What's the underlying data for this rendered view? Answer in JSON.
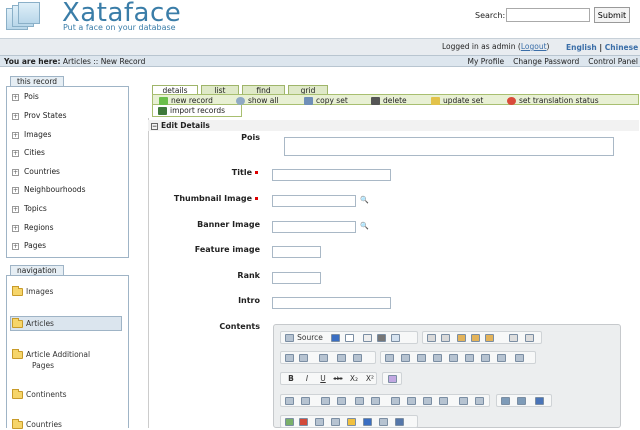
{
  "header": {
    "brand": "Xataface",
    "tagline": "Put a face on your database",
    "search_label": "Search:",
    "search_value": "",
    "submit_label": "Submit"
  },
  "status_bar": {
    "logged_in_prefix": "Logged in as admin (",
    "logout_label": "Logout",
    "logged_in_suffix": ")",
    "lang_english": "English",
    "lang_separator": "|",
    "lang_chinese": "Chinese"
  },
  "breadcrumb": {
    "prefix": "You are here:",
    "path": "Articles :: New Record"
  },
  "user_links": [
    "My Profile",
    "Change Password",
    "Control Panel"
  ],
  "sidebar": {
    "this_record_title": "this record",
    "record_items": [
      "Pois",
      "Prov States",
      "Images",
      "Cities",
      "Countries",
      "Neighbourhoods",
      "Topics",
      "Regions",
      "Pages"
    ],
    "navigation_title": "navigation",
    "nav_items": [
      {
        "label": "Images",
        "line2": ""
      },
      {
        "label": "Articles",
        "line2": ""
      },
      {
        "label": "Article Additional",
        "line2": "Pages"
      },
      {
        "label": "Continents",
        "line2": ""
      },
      {
        "label": "Countries",
        "line2": ""
      }
    ]
  },
  "tabs": [
    "details",
    "list",
    "find",
    "grid"
  ],
  "actions": {
    "new_record": "new record",
    "show_all": "show all",
    "copy_set": "copy set",
    "delete": "delete",
    "update_set": "update set",
    "set_translation_status": "set translation status",
    "import_records": "import records"
  },
  "section_title": "Edit Details",
  "fields": {
    "pois": "Pois",
    "title": "Title",
    "thumbnail_image": "Thumbnail Image",
    "banner_image": "Banner Image",
    "feature_image": "Feature image",
    "rank": "Rank",
    "intro": "Intro",
    "contents": "Contents"
  },
  "editor": {
    "source_label": "Source",
    "bold": "B",
    "italic": "I",
    "underline": "U",
    "strike": "abc",
    "subscript": "X₂",
    "superscript": "X²"
  }
}
